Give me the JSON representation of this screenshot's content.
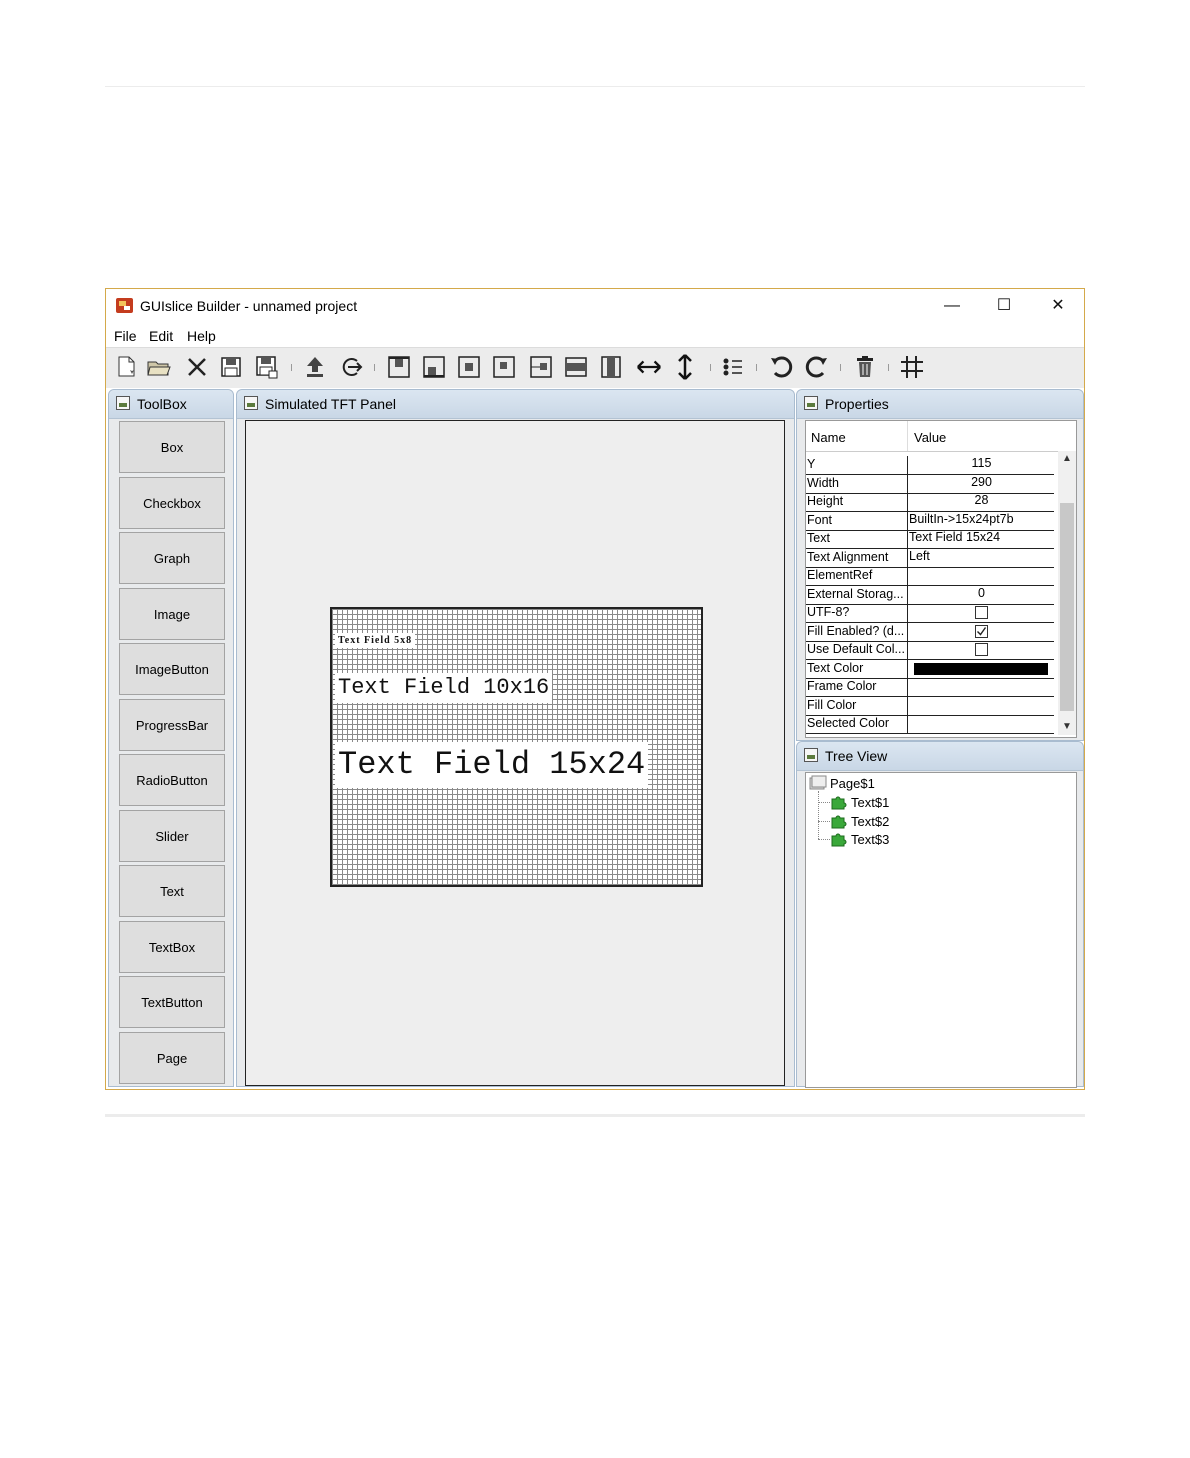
{
  "window": {
    "title": "GUIslice Builder - unnamed project",
    "minimize_glyph": "—",
    "maximize_glyph": "☐",
    "close_glyph": "✕"
  },
  "menu": [
    "File",
    "Edit",
    "Help"
  ],
  "toolbar": {
    "icons": [
      "new-file-icon",
      "open-folder-icon",
      "close-icon",
      "save-icon",
      "save-as-icon",
      "export-icon",
      "exit-icon",
      "align-top-icon",
      "align-bottom-icon",
      "align-center-icon",
      "align-hcenter-icon",
      "align-left-icon",
      "align-width-icon",
      "align-height-icon",
      "expand-horizontal-icon",
      "expand-vertical-icon",
      "list-icon",
      "undo-icon",
      "redo-icon",
      "delete-icon",
      "grid-icon"
    ]
  },
  "toolbox": {
    "title": "ToolBox",
    "buttons": [
      "Box",
      "Checkbox",
      "Graph",
      "Image",
      "ImageButton",
      "ProgressBar",
      "RadioButton",
      "Slider",
      "Text",
      "TextBox",
      "TextButton",
      "Page"
    ]
  },
  "tft_panel": {
    "title": "Simulated TFT Panel",
    "fields": [
      "Text Field 5x8",
      "Text Field 10x16",
      "Text Field 15x24"
    ]
  },
  "properties": {
    "title": "Properties",
    "col_name": "Name",
    "col_value": "Value",
    "rows": [
      {
        "name": "Y",
        "value": "115",
        "align": "center"
      },
      {
        "name": "Width",
        "value": "290",
        "align": "center"
      },
      {
        "name": "Height",
        "value": "28",
        "align": "center"
      },
      {
        "name": "Font",
        "value": "BuiltIn->15x24pt7b",
        "align": "left"
      },
      {
        "name": "Text",
        "value": "Text Field 15x24",
        "align": "left"
      },
      {
        "name": "Text Alignment",
        "value": "Left",
        "align": "left"
      },
      {
        "name": "ElementRef",
        "value": "",
        "align": "left"
      },
      {
        "name": "External Storag...",
        "value": "0",
        "align": "center"
      },
      {
        "name": "UTF-8?",
        "checked": false
      },
      {
        "name": "Fill Enabled? (d...",
        "checked": true
      },
      {
        "name": "Use Default Col...",
        "checked": false
      },
      {
        "name": "Text Color",
        "color": "#000000"
      },
      {
        "name": "Frame Color",
        "value": "",
        "align": "left"
      },
      {
        "name": "Fill Color",
        "value": "",
        "align": "left"
      },
      {
        "name": "Selected Color",
        "value": "",
        "align": "left"
      }
    ]
  },
  "tree_view": {
    "title": "Tree View",
    "root": "Page$1",
    "children": [
      "Text$1",
      "Text$2",
      "Text$3"
    ]
  }
}
